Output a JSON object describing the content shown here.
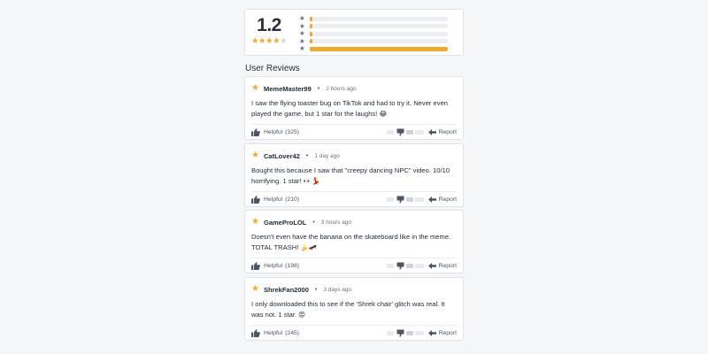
{
  "summary": {
    "average": "1.2",
    "average_value": 1.2,
    "distribution": [
      {
        "stars": 5,
        "fraction": 0.02
      },
      {
        "stars": 4,
        "fraction": 0.02
      },
      {
        "stars": 3,
        "fraction": 0.02
      },
      {
        "stars": 2,
        "fraction": 0.02
      },
      {
        "stars": 1,
        "fraction": 1.0
      }
    ]
  },
  "section_title": "User Reviews",
  "reviews": [
    {
      "user": "MemeMaster99",
      "time": "2 hours ago",
      "rating": 1,
      "text": "I saw the flying toaster bug on TikTok and had to try it. Never even played the game, but 1 star for the laughs! 😂",
      "helpful_label": "Helpful",
      "helpful_count": "(325)",
      "report_label": "Report"
    },
    {
      "user": "CatLover42",
      "time": "1 day ago",
      "rating": 1,
      "text": "Bought this because I saw that \"creepy dancing NPC\" video. 10/10 horrifying. 1 star! 👀💃",
      "helpful_label": "Helpful",
      "helpful_count": "(210)",
      "report_label": "Report"
    },
    {
      "user": "GameProLOL",
      "time": "3 hours ago",
      "rating": 1,
      "text": "Doesn't even have the banana on the skateboard like in the meme. TOTAL TRASH! 🍌🛹",
      "helpful_label": "Helpful",
      "helpful_count": "(198)",
      "report_label": "Report"
    },
    {
      "user": "ShrekFan2000",
      "time": "3 days ago",
      "rating": 1,
      "text": "I only downloaded this to see if the 'Shrek chair' glitch was real. It was not. 1 star. 😡",
      "helpful_label": "Helpful",
      "helpful_count": "(245)",
      "report_label": "Report"
    }
  ],
  "colors": {
    "accent_star": "#f1a92b",
    "bar_fill": "#f0a92b",
    "bar_track": "#eceef1",
    "card_border": "#dfe2e6",
    "background": "#f5f6f8"
  },
  "icons": {
    "star": "star-icon",
    "helpful": "thumbs-up-icon",
    "dislike": "thumbs-down-icon",
    "report": "flag-icon"
  }
}
